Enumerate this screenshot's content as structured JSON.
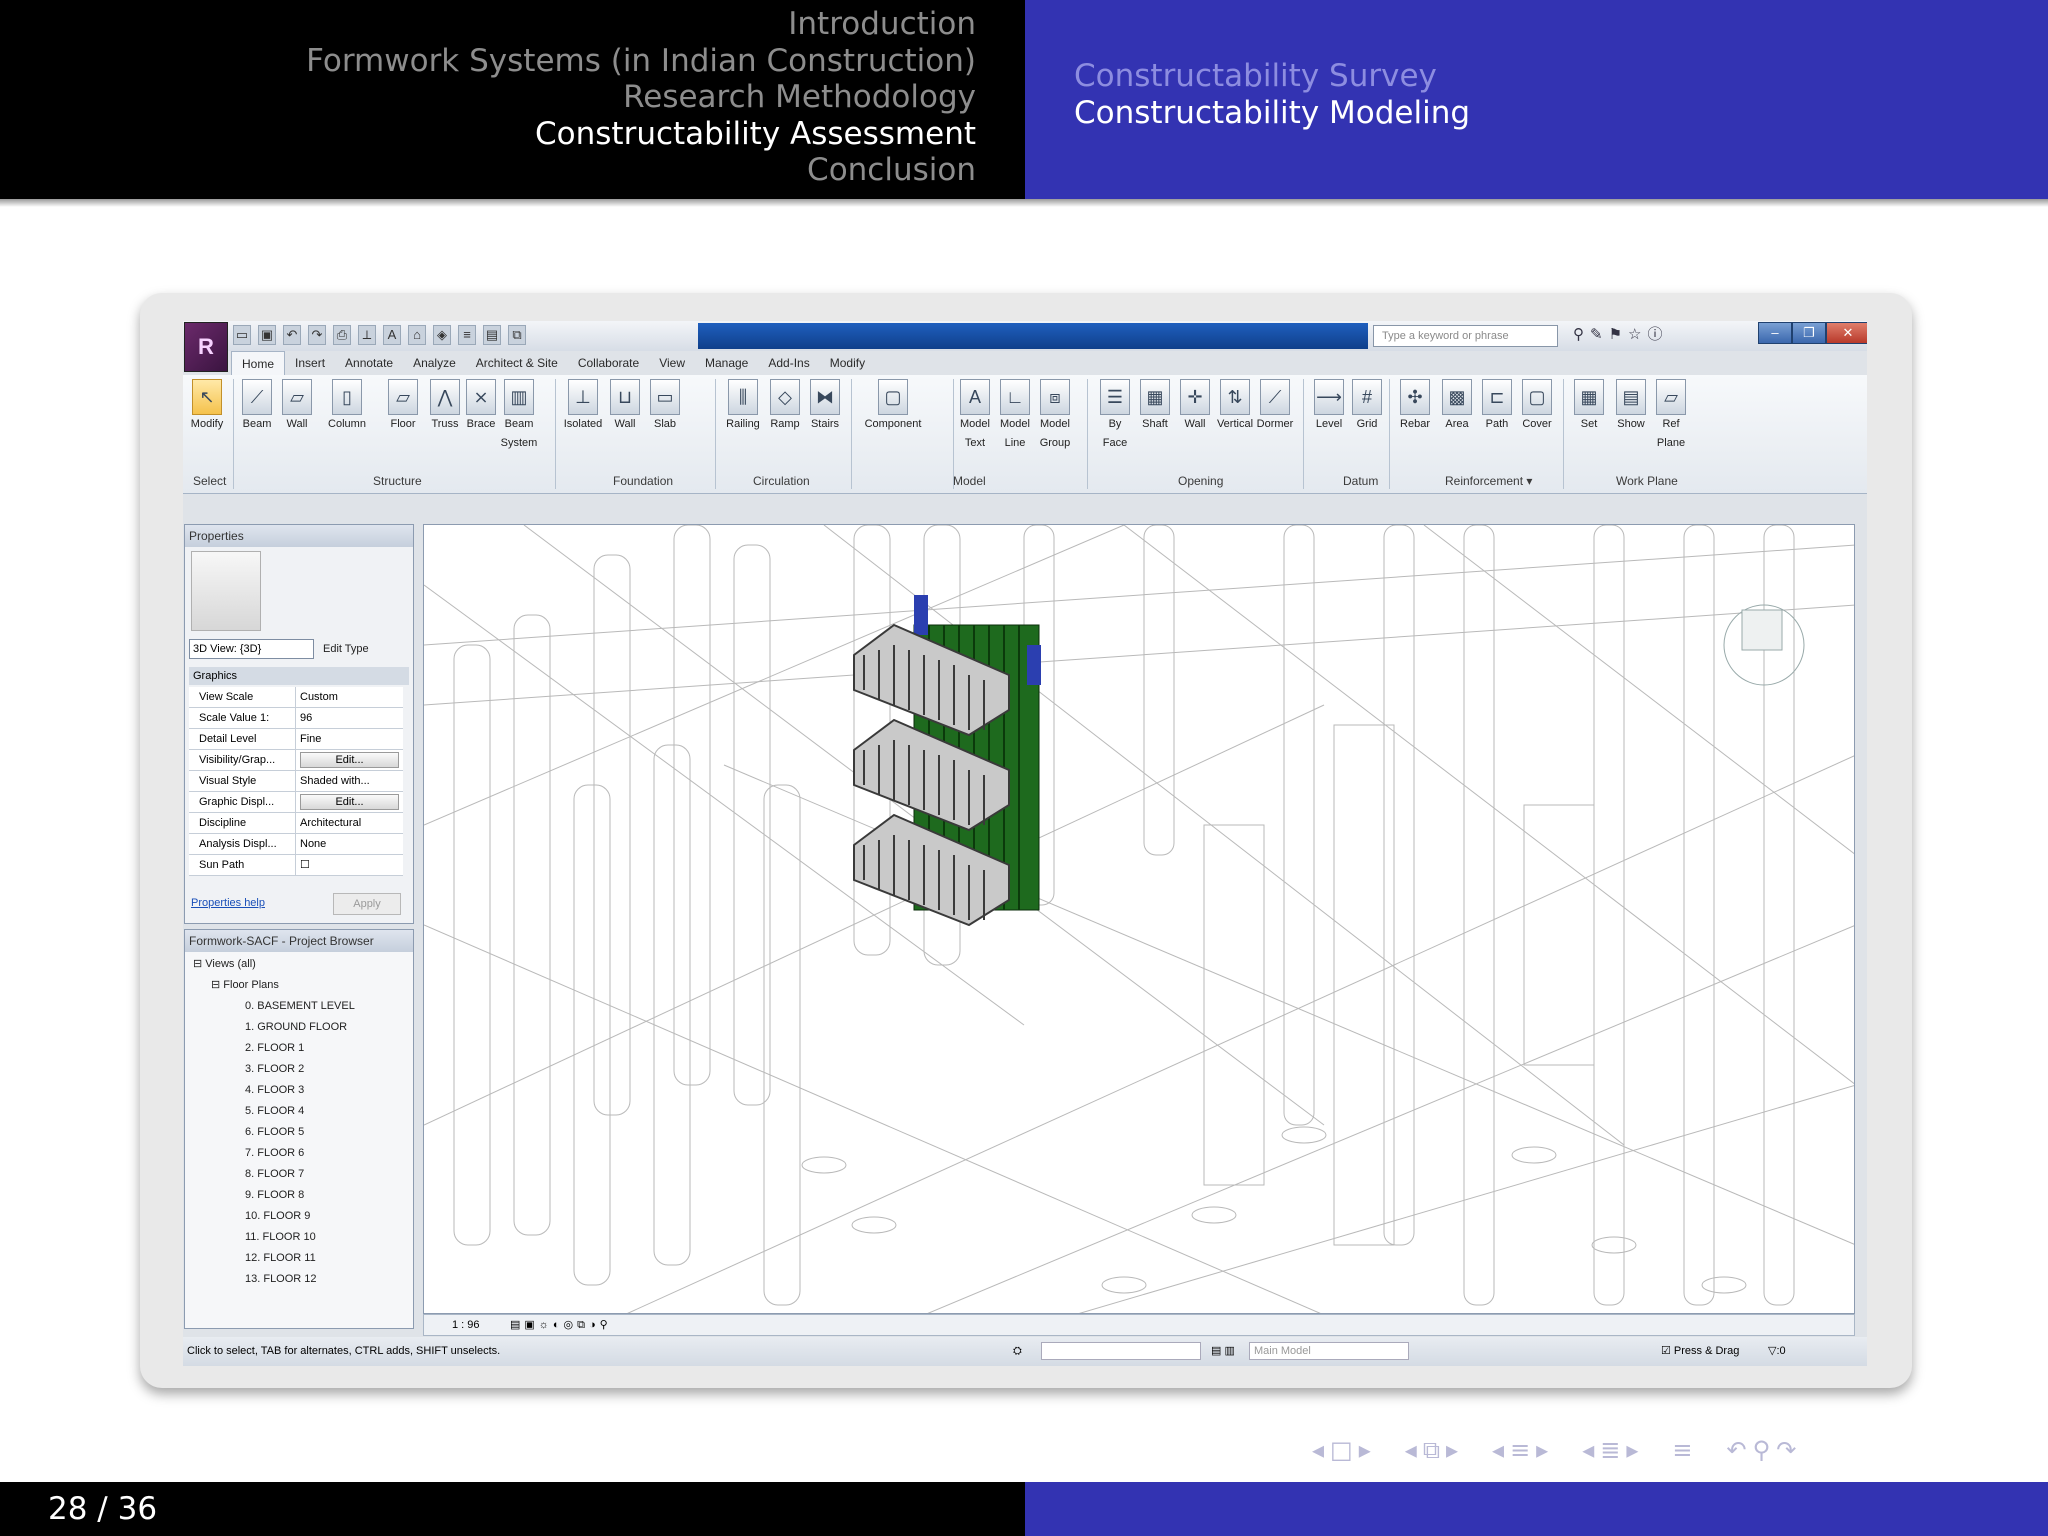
{
  "header": {
    "sections": [
      {
        "label": "Introduction",
        "active": false
      },
      {
        "label": "Formwork Systems (in Indian Construction)",
        "active": false
      },
      {
        "label": "Research Methodology",
        "active": false
      },
      {
        "label": "Constructability Assessment",
        "active": true
      },
      {
        "label": "Conclusion",
        "active": false
      }
    ],
    "subsections": [
      {
        "label": "Constructability Survey",
        "active": false
      },
      {
        "label": "Constructability Modeling",
        "active": true
      }
    ]
  },
  "footer": {
    "page": "28 / 36"
  },
  "app": {
    "search_placeholder": "Type a keyword or phrase",
    "tabs": [
      "Home",
      "Insert",
      "Annotate",
      "Analyze",
      "Architect & Site",
      "Collaborate",
      "View",
      "Manage",
      "Add-Ins",
      "Modify"
    ],
    "tools": {
      "modify": "Modify",
      "beam": "Beam",
      "wall": "Wall",
      "column": "Column",
      "floor": "Floor",
      "truss": "Truss",
      "brace": "Brace",
      "beam_system": "Beam\nSystem",
      "isolated": "Isolated",
      "wall_found": "Wall",
      "slab": "Slab",
      "railing": "Railing",
      "ramp": "Ramp",
      "stairs": "Stairs",
      "component": "Component",
      "model_text": "Model\nText",
      "model_line": "Model\nLine",
      "model_group": "Model\nGroup",
      "by_face": "By\nFace",
      "shaft": "Shaft",
      "wall_open": "Wall",
      "vertical": "Vertical",
      "dormer": "Dormer",
      "level": "Level",
      "grid": "Grid",
      "rebar": "Rebar",
      "area": "Area",
      "path": "Path",
      "cover": "Cover",
      "set": "Set",
      "show": "Show",
      "ref_plane": "Ref\nPlane"
    },
    "panels": {
      "select": "Select",
      "structure": "Structure",
      "foundation": "Foundation",
      "circulation": "Circulation",
      "model": "Model",
      "opening": "Opening",
      "datum": "Datum",
      "reinforcement": "Reinforcement ▾",
      "work_plane": "Work Plane"
    },
    "properties": {
      "title": "Properties",
      "view_type": "3D View: {3D}",
      "edit_type": "Edit Type",
      "group": "Graphics",
      "rows": [
        {
          "k": "View Scale",
          "v": "Custom"
        },
        {
          "k": "Scale Value    1:",
          "v": "96"
        },
        {
          "k": "Detail Level",
          "v": "Fine"
        },
        {
          "k": "Visibility/Grap...",
          "v": "Edit..."
        },
        {
          "k": "Visual Style",
          "v": "Shaded with..."
        },
        {
          "k": "Graphic Displ...",
          "v": "Edit..."
        },
        {
          "k": "Discipline",
          "v": "Architectural"
        },
        {
          "k": "Analysis Displ...",
          "v": "None"
        },
        {
          "k": "Sun Path",
          "v": ""
        }
      ],
      "help_link": "Properties help",
      "apply": "Apply"
    },
    "browser": {
      "title": "Formwork-SACF - Project Browser",
      "root": "Views (all)",
      "group": "Floor Plans",
      "items": [
        "0. BASEMENT LEVEL",
        "1. GROUND FLOOR",
        "2. FLOOR 1",
        "3. FLOOR 2",
        "4. FLOOR 3",
        "5. FLOOR 4",
        "6. FLOOR 5",
        "7. FLOOR 6",
        "8. FLOOR 7",
        "9. FLOOR 8",
        "10. FLOOR 9",
        "11. FLOOR 10",
        "12. FLOOR 11",
        "13. FLOOR 12"
      ]
    },
    "view_scale": "1 : 96",
    "status_text": "Click to select, TAB for alternates, CTRL adds, SHIFT unselects.",
    "main_model": "Main Model",
    "press_drag": "Press & Drag",
    "filter_count": ":0"
  },
  "colors": {
    "beamer_blue": "#3333b2",
    "formwork_green": "#1e6a1e"
  }
}
